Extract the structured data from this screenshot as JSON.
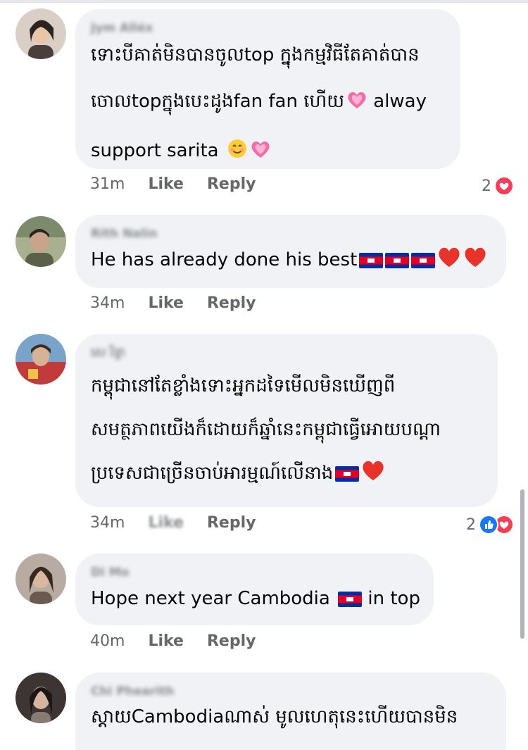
{
  "comments": [
    {
      "author": "Jym Alléx",
      "lines": [
        "ទោះបីគាត់មិនបានចូលtop ក្នុងកម្មវិធីតែគាត់បាន",
        "ចោលtopក្នុងបេះដូងfan fan ហើយ",
        "support sarita"
      ],
      "line2_tail": "alway",
      "time": "31m",
      "like": "Like",
      "reply": "Reply",
      "reaction_count": "2"
    },
    {
      "author": "Rith Nalin",
      "lines": [
        "He has already done his best"
      ],
      "time": "34m",
      "like": "Like",
      "reply": "Reply"
    },
    {
      "author": "សេ រិទ្ធា",
      "lines": [
        "កម្ពុជានៅតែខ្លាំងទោះអ្នកដទៃមើលមិនឃើញពី",
        "សមត្ថភាពយើងក៏ដោយក៏ឆ្នាំនេះកម្ពុជាធ្វើអោយបណ្តា",
        "ប្រទេសជាច្រើនចាប់អារម្មណ៍លើនាង"
      ],
      "time": "34m",
      "like": "Like",
      "reply": "Reply",
      "reaction_count": "2"
    },
    {
      "author": "Di Mo",
      "lines": [
        "Hope next year Cambodia"
      ],
      "line1_tail": "in top",
      "time": "40m",
      "like": "Like",
      "reply": "Reply"
    },
    {
      "author": "Chi Phearith",
      "lines": [
        "ស្តាយCambodiaណាស់ មូលហេតុនេះហើយបានមិន"
      ]
    }
  ],
  "icons": {
    "emoji_heart": "sparkling-heart-icon",
    "emoji_smile": "smiling-face-icon",
    "emoji_red_heart": "red-heart-icon",
    "flag": "cambodia-flag-icon",
    "reaction_love": "love-reaction-icon",
    "reaction_like": "like-reaction-icon"
  },
  "colors": {
    "bubble": "#f0f2f5",
    "meta_text": "#65676b",
    "love": "#f33e58",
    "like": "#1877f2"
  }
}
